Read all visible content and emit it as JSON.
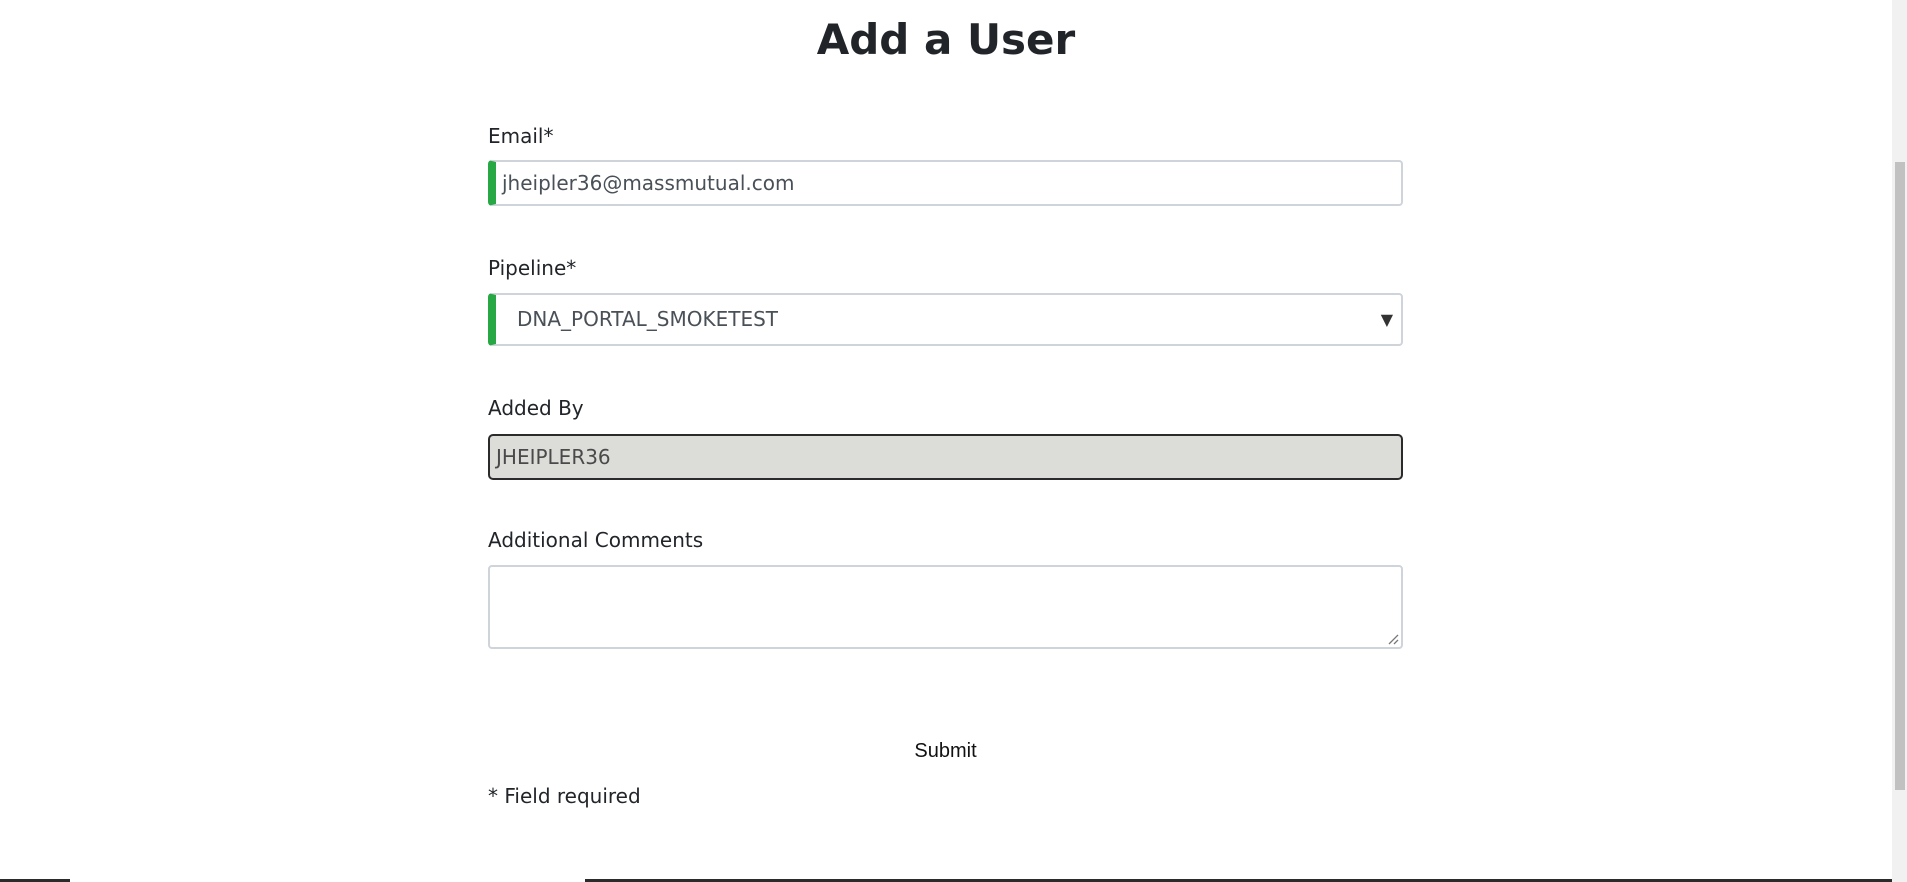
{
  "page": {
    "title": "Add a User"
  },
  "form": {
    "email": {
      "label": "Email*",
      "value": "jheipler36@massmutual.com"
    },
    "pipeline": {
      "label": "Pipeline*",
      "selected": "DNA_PORTAL_SMOKETEST",
      "caret": "▼"
    },
    "added_by": {
      "label": "Added By",
      "value": "JHEIPLER36"
    },
    "comments": {
      "label": "Additional Comments",
      "value": ""
    },
    "submit_label": "Submit",
    "required_note": "* Field required"
  },
  "colors": {
    "valid_accent": "#28a745",
    "readonly_background": "#dcdcd8"
  },
  "icons": {
    "select_caret": "chevron-down-icon",
    "resize_handle": "resize-handle-icon"
  }
}
